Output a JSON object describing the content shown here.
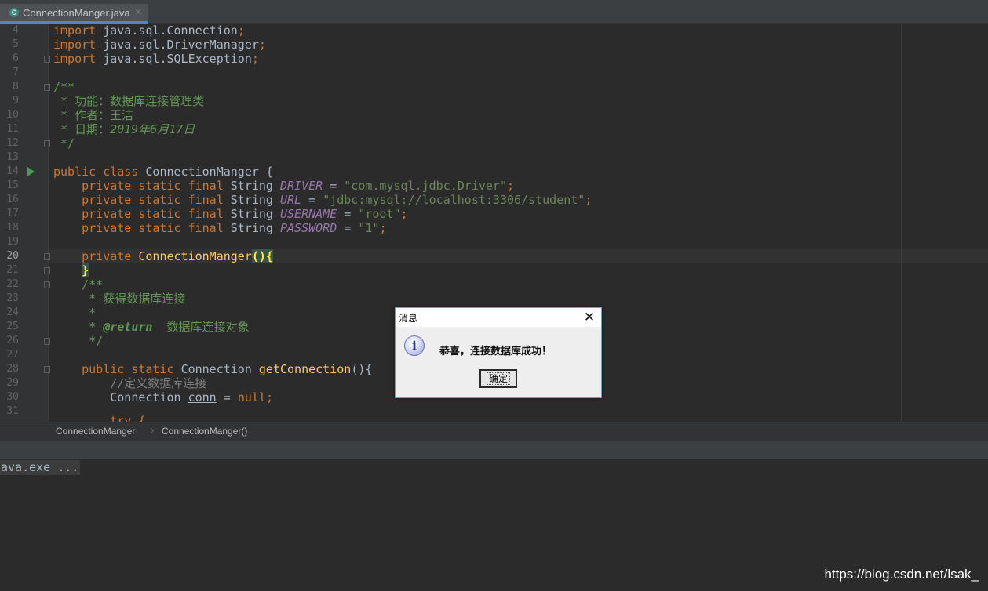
{
  "tab": {
    "icon": "C",
    "label": "ConnectionManger.java",
    "close": "×"
  },
  "lines": [
    "4",
    "5",
    "6",
    "7",
    "8",
    "9",
    "10",
    "11",
    "12",
    "13",
    "14",
    "15",
    "16",
    "17",
    "18",
    "19",
    "20",
    "21",
    "22",
    "23",
    "24",
    "25",
    "26",
    "27",
    "28",
    "29",
    "30",
    "31"
  ],
  "code": {
    "l4": {
      "kw": "import",
      "rest": " java.sql.Connection",
      "semi": ";"
    },
    "l5": {
      "kw": "import",
      "rest": " java.sql.DriverManager",
      "semi": ";"
    },
    "l6": {
      "kw": "import",
      "rest": " java.sql.SQLException",
      "semi": ";"
    },
    "l8": "/**",
    "l9": " * 功能：数据库连接管理类",
    "l10": " * 作者：王洁",
    "l11a": " * 日期：",
    "l11b": "2019年6月17日",
    "l12": " */",
    "l14a": "public class ",
    "l14b": "ConnectionManger {",
    "fields": [
      {
        "mods": "    private static final ",
        "type": "String ",
        "name": "DRIVER",
        "eq": " = ",
        "val": "\"com.mysql.jdbc.Driver\"",
        "semi": ";"
      },
      {
        "mods": "    private static final ",
        "type": "String ",
        "name": "URL",
        "eq": " = ",
        "val": "\"jdbc:mysql://localhost:3306/student\"",
        "semi": ";"
      },
      {
        "mods": "    private static final ",
        "type": "String ",
        "name": "USERNAME",
        "eq": " = ",
        "val": "\"root\"",
        "semi": ";"
      },
      {
        "mods": "    private static final ",
        "type": "String ",
        "name": "PASSWORD",
        "eq": " = ",
        "val": "\"1\"",
        "semi": ";"
      }
    ],
    "l20a": "    private ",
    "l20b": "ConnectionManger",
    "l20c": "()",
    "l20d": "{",
    "l21a": "    ",
    "l21b": "}",
    "l22": "    /**",
    "l23": "     * 获得数据库连接",
    "l24": "     *",
    "l25a": "     * ",
    "l25b": "@return",
    "l25c": "  数据库连接对象",
    "l26": "     */",
    "l28a": "    public static ",
    "l28b": "Connection ",
    "l28c": "getConnection",
    "l28d": "(){",
    "l29": "        //定义数据库连接",
    "l30a": "        Connection ",
    "l30b": "conn",
    "l30c": " = ",
    "l30d": "null",
    "l30e": ";",
    "l31": "        try {"
  },
  "breadcrumb": {
    "class": "ConnectionManger",
    "separator": "›",
    "method": "ConnectionManger()"
  },
  "console": {
    "line": "ava.exe ..."
  },
  "watermark": "https://blog.csdn.net/lsak_",
  "dialog": {
    "title": "消息",
    "close": "✕",
    "icon": "i",
    "message": "恭喜，连接数据库成功！",
    "ok": "确定"
  }
}
